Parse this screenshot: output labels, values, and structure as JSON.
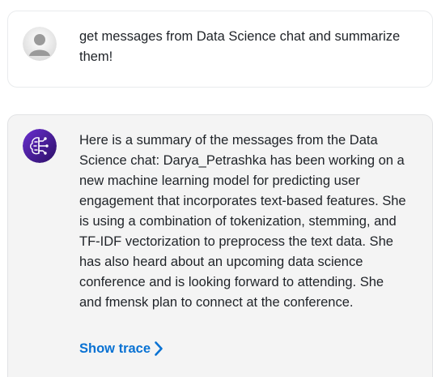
{
  "conversation": {
    "user_message": {
      "avatar_icon": "user-silhouette-icon",
      "text": "get messages from Data Science chat and summarize them!"
    },
    "assistant_message": {
      "avatar_icon": "ai-brain-icon",
      "text": "Here is a summary of the messages from the Data Science chat: Darya_Petrashka has been working on a new machine learning model for predicting user engagement that incorporates text-based features. She is using a combination of tokenization, stemming, and TF-IDF vectorization to preprocess the text data. She has also heard about an upcoming data science conference and is looking forward to attending. She and fmensk plan to connect at the conference.",
      "show_trace_label": "Show trace",
      "show_trace_icon": "chevron-right-icon"
    }
  },
  "colors": {
    "link": "#0972d3",
    "assistant_bg": "#f4f4f4",
    "avatar_gradient_start": "#6a2fd0",
    "avatar_gradient_end": "#2c0f66"
  }
}
